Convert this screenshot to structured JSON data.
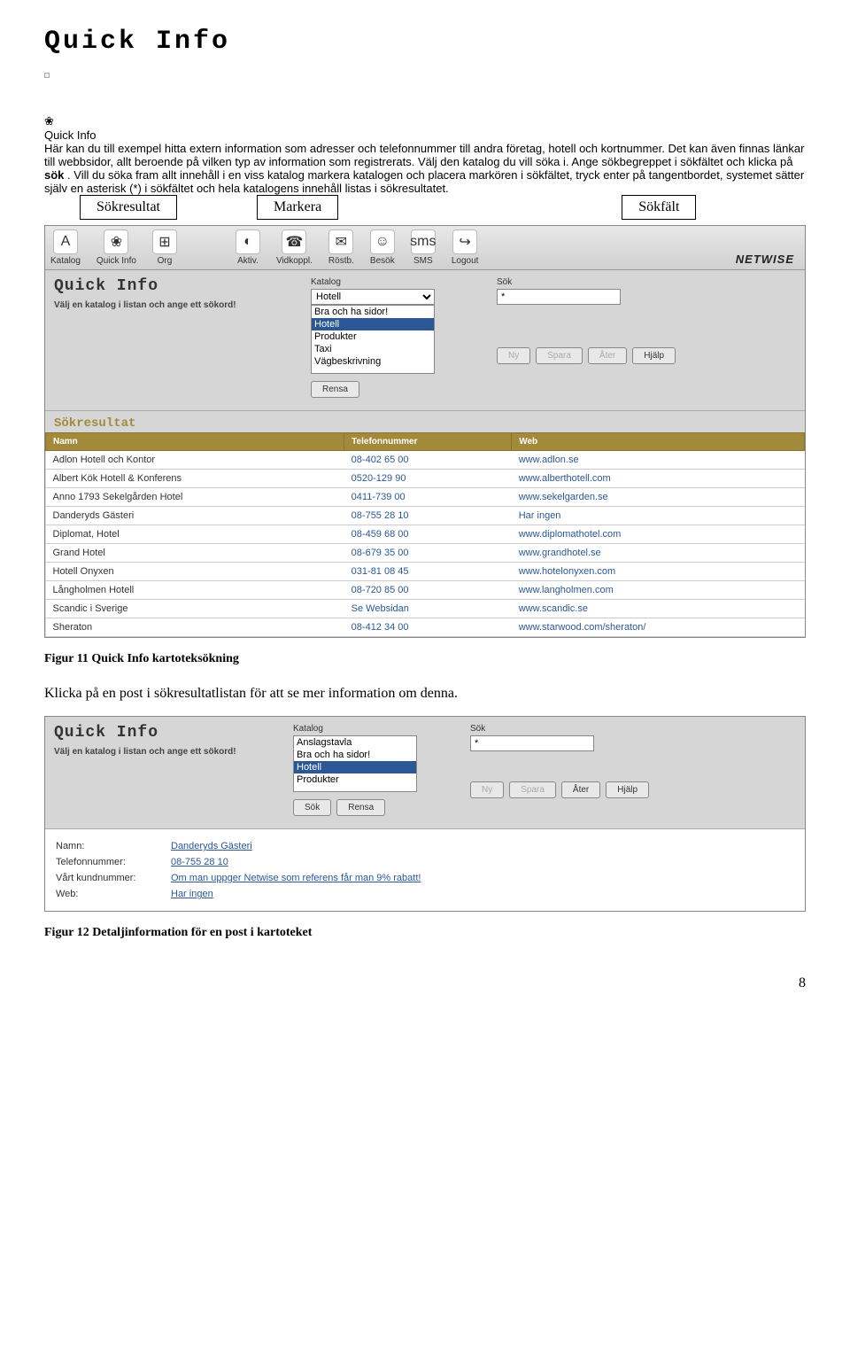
{
  "doc": {
    "title": "Quick Info",
    "intro_prefix": " Här kan du till exempel hitta extern information som adresser och telefonnummer till andra företag, hotell och kortnummer. Det kan även finnas länkar till webbsidor, allt beroende på vilken typ av information som registrerats. Välj den katalog du vill söka i. Ange sökbegreppet i sökfältet och klicka på ",
    "intro_bold": "sök",
    "intro_suffix": ". Vill du söka fram allt innehåll i en viss katalog markera katalogen och placera markören i sökfältet, tryck enter på tangentbordet, systemet sätter själv en asterisk (*) i sökfältet och hela katalogens innehåll listas i sökresultatet.",
    "qi_icon_caption": "Quick Info",
    "labels": {
      "l1": "Sökresultat",
      "l2": "Markera",
      "l3": "Sökfält"
    },
    "caption1": "Figur 11  Quick Info kartoteksökning",
    "body2": "Klicka på en post i sökresultatlistan för att se mer information om denna.",
    "caption2": "Figur 12  Detaljinformation för en post i kartoteket",
    "page": "8"
  },
  "toolbar": {
    "items": [
      {
        "glyph": "A",
        "label": "Katalog"
      },
      {
        "glyph": "❀",
        "label": "Quick Info"
      },
      {
        "glyph": "⊞",
        "label": "Org"
      },
      {
        "glyph": "◐",
        "label": "Aktiv."
      },
      {
        "glyph": "☎",
        "label": "Vidkoppl."
      },
      {
        "glyph": "✉",
        "label": "Röstb."
      },
      {
        "glyph": "☺",
        "label": "Besök"
      },
      {
        "glyph": "sms",
        "label": "SMS"
      },
      {
        "glyph": "↪",
        "label": "Logout"
      }
    ],
    "brand": "NETWISE"
  },
  "qi": {
    "title": "Quick Info",
    "subtitle": "Välj en katalog i listan och ange ett sökord!",
    "katalog_label": "Katalog",
    "katalog_selected": "Hotell",
    "katalog_options": [
      "Bra och ha sidor!",
      "Hotell",
      "Produkter",
      "Taxi",
      "Vägbeskrivning"
    ],
    "sok_label": "Sök",
    "sok_value": "*",
    "btn_rensa": "Rensa",
    "btn_ny": "Ny",
    "btn_spara": "Spara",
    "btn_ater": "Åter",
    "btn_hjalp": "Hjälp",
    "btn_sok": "Sök",
    "sokresultat": "Sökresultat",
    "columns": {
      "name": "Namn",
      "tel": "Telefonnummer",
      "web": "Web"
    },
    "rows": [
      {
        "name": "Adlon Hotell och Kontor",
        "tel": "08-402 65 00",
        "web": "www.adlon.se"
      },
      {
        "name": "Albert Kök Hotell & Konferens",
        "tel": "0520-129 90",
        "web": "www.alberthotell.com"
      },
      {
        "name": "Anno 1793 Sekelgården Hotel",
        "tel": "0411-739 00",
        "web": "www.sekelgarden.se"
      },
      {
        "name": "Danderyds Gästeri",
        "tel": "08-755 28 10",
        "web": "Har ingen"
      },
      {
        "name": "Diplomat, Hotel",
        "tel": "08-459 68 00",
        "web": "www.diplomathotel.com"
      },
      {
        "name": "Grand Hotel",
        "tel": "08-679 35 00",
        "web": "www.grandhotel.se"
      },
      {
        "name": "Hotell Onyxen",
        "tel": "031-81 08 45",
        "web": "www.hotelonyxen.com"
      },
      {
        "name": "Långholmen Hotell",
        "tel": "08-720 85 00",
        "web": "www.langholmen.com"
      },
      {
        "name": "Scandic i Sverige",
        "tel": "Se Websidan",
        "web": "www.scandic.se"
      },
      {
        "name": "Sheraton",
        "tel": "08-412 34 00",
        "web": "www.starwood.com/sheraton/"
      }
    ]
  },
  "qi2": {
    "katalog_options": [
      "Anslagstavla",
      "Bra och ha sidor!",
      "Hotell",
      "Produkter"
    ],
    "katalog_selected": "Hotell",
    "detail": [
      {
        "k": "Namn:",
        "v": "Danderyds Gästeri"
      },
      {
        "k": "Telefonnummer:",
        "v": "08-755 28 10"
      },
      {
        "k": "Vårt kundnummer:",
        "v": "Om man uppger Netwise som referens får man 9% rabatt!"
      },
      {
        "k": "Web:",
        "v": "Har ingen"
      }
    ]
  }
}
